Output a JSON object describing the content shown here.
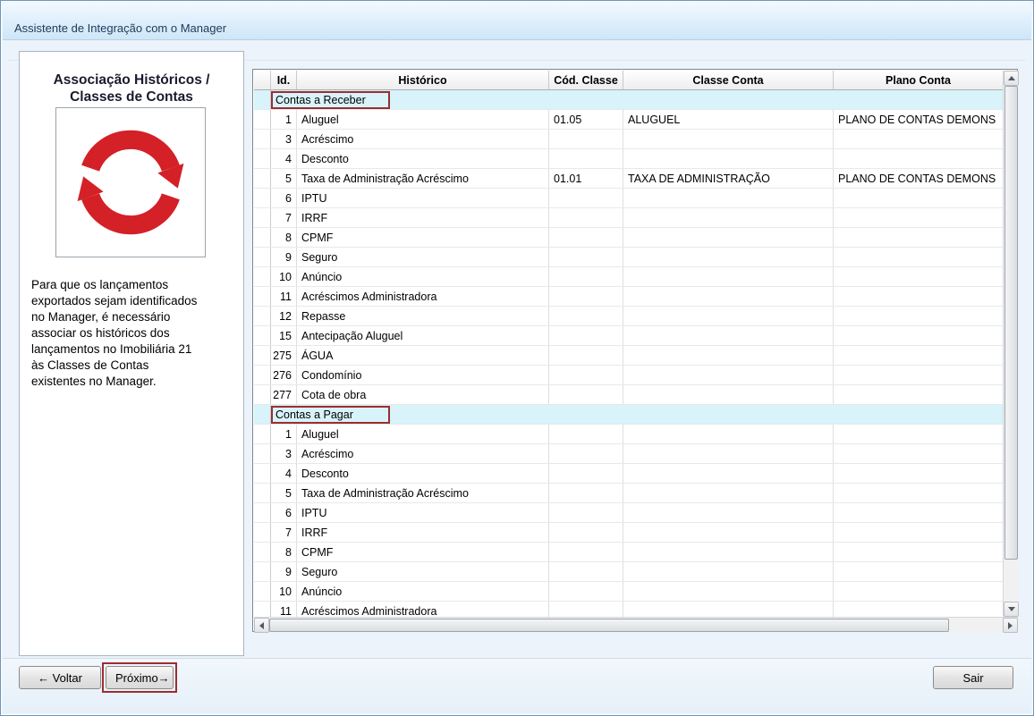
{
  "window": {
    "title": "Assistente de Integração com o Manager"
  },
  "sidebar": {
    "heading": "Associação Históricos /\nClasses de Contas",
    "description": "Para que os lançamentos\nexportados sejam identificados\nno Manager, é necessário\nassociar os históricos dos\nlançamentos no Imobiliária 21\nàs Classes de Contas\nexistentes no Manager.",
    "icon": "red-cycle-arrows-icon"
  },
  "grid": {
    "columns": [
      "Id.",
      "Histórico",
      "Cód. Classe",
      "Classe Conta",
      "Plano Conta"
    ],
    "groups": [
      {
        "label": "Contas a Receber",
        "rows": [
          [
            "1",
            "Aluguel",
            "01.05",
            "ALUGUEL",
            "PLANO DE CONTAS DEMONS"
          ],
          [
            "3",
            "Acréscimo",
            "",
            "",
            ""
          ],
          [
            "4",
            "Desconto",
            "",
            "",
            ""
          ],
          [
            "5",
            "Taxa de Administração Acréscimo",
            "01.01",
            "TAXA DE ADMINISTRAÇÃO",
            "PLANO DE CONTAS DEMONS"
          ],
          [
            "6",
            "IPTU",
            "",
            "",
            ""
          ],
          [
            "7",
            "IRRF",
            "",
            "",
            ""
          ],
          [
            "8",
            "CPMF",
            "",
            "",
            ""
          ],
          [
            "9",
            "Seguro",
            "",
            "",
            ""
          ],
          [
            "10",
            "Anúncio",
            "",
            "",
            ""
          ],
          [
            "11",
            "Acréscimos Administradora",
            "",
            "",
            ""
          ],
          [
            "12",
            "Repasse",
            "",
            "",
            ""
          ],
          [
            "15",
            "Antecipação Aluguel",
            "",
            "",
            ""
          ],
          [
            "275",
            "ÁGUA",
            "",
            "",
            ""
          ],
          [
            "276",
            "Condomínio",
            "",
            "",
            ""
          ],
          [
            "277",
            "Cota de obra",
            "",
            "",
            ""
          ]
        ]
      },
      {
        "label": "Contas a Pagar",
        "rows": [
          [
            "1",
            "Aluguel",
            "",
            "",
            ""
          ],
          [
            "3",
            "Acréscimo",
            "",
            "",
            ""
          ],
          [
            "4",
            "Desconto",
            "",
            "",
            ""
          ],
          [
            "5",
            "Taxa de Administração Acréscimo",
            "",
            "",
            ""
          ],
          [
            "6",
            "IPTU",
            "",
            "",
            ""
          ],
          [
            "7",
            "IRRF",
            "",
            "",
            ""
          ],
          [
            "8",
            "CPMF",
            "",
            "",
            ""
          ],
          [
            "9",
            "Seguro",
            "",
            "",
            ""
          ],
          [
            "10",
            "Anúncio",
            "",
            "",
            ""
          ],
          [
            "11",
            "Acréscimos Administradora",
            "",
            "",
            ""
          ]
        ]
      }
    ]
  },
  "footer": {
    "back": "← Voltar",
    "next": "Próximo→",
    "exit": "Sair"
  },
  "colors": {
    "annotation_red": "#9c2d31",
    "group_row_background": "#d8f3fa",
    "icon_red": "#d42027",
    "titlebar_text": "#1c3a58"
  }
}
